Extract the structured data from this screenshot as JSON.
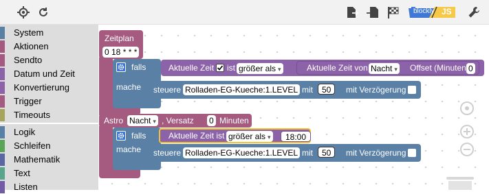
{
  "toolbar": {
    "badge_blockly": "blockly",
    "badge_js": "JS"
  },
  "sidebar": {
    "items": [
      {
        "label": "System",
        "color": "#5b80a5"
      },
      {
        "label": "Aktionen",
        "color": "#a55b80"
      },
      {
        "label": "Sendto",
        "color": "#a55b80"
      },
      {
        "label": "Datum und Zeit",
        "color": "#8c62a8"
      },
      {
        "label": "Konvertierung",
        "color": "#8c62a8"
      },
      {
        "label": "Trigger",
        "color": "#a55b80"
      },
      {
        "label": "Timeouts",
        "color": "#a5a55b"
      },
      {
        "label": "Logik",
        "color": "#5b80a5"
      },
      {
        "label": "Schleifen",
        "color": "#5ba55b"
      },
      {
        "label": "Mathematik",
        "color": "#5b67a5"
      },
      {
        "label": "Text",
        "color": "#5ba58c"
      },
      {
        "label": "Listen",
        "color": "#745ba5"
      }
    ]
  },
  "schedule": {
    "title": "Zeitplan",
    "cron": "0 18 * * *",
    "if1": {
      "falls": "falls",
      "cond_label": "Aktuelle Zeit",
      "ist": "ist",
      "op": "größer als",
      "right_label": "Aktuelle Zeit von",
      "right_value": "Nacht",
      "offset_label": "Offset (Minuten)",
      "offset_value": "0",
      "mache": "mache",
      "action_label": "steuere",
      "device": "Rolladen-EG-Kueche:1.LEVEL",
      "mit": "mit",
      "value": "50",
      "delay_label": "mit Verzögerung"
    }
  },
  "astro": {
    "label": "Astro",
    "value": "Nacht",
    "offset_label": ", Versatz",
    "offset_value": "0",
    "unit": "Minuten",
    "if2": {
      "falls": "falls",
      "cond_label": "Aktuelle Zeit ist",
      "op": "größer als",
      "time": "18:00",
      "mache": "mache",
      "action_label": "steuere",
      "device": "Rolladen-EG-Kueche:1.LEVEL",
      "mit": "mit",
      "value": "50",
      "delay_label": "mit Verzögerung"
    }
  }
}
